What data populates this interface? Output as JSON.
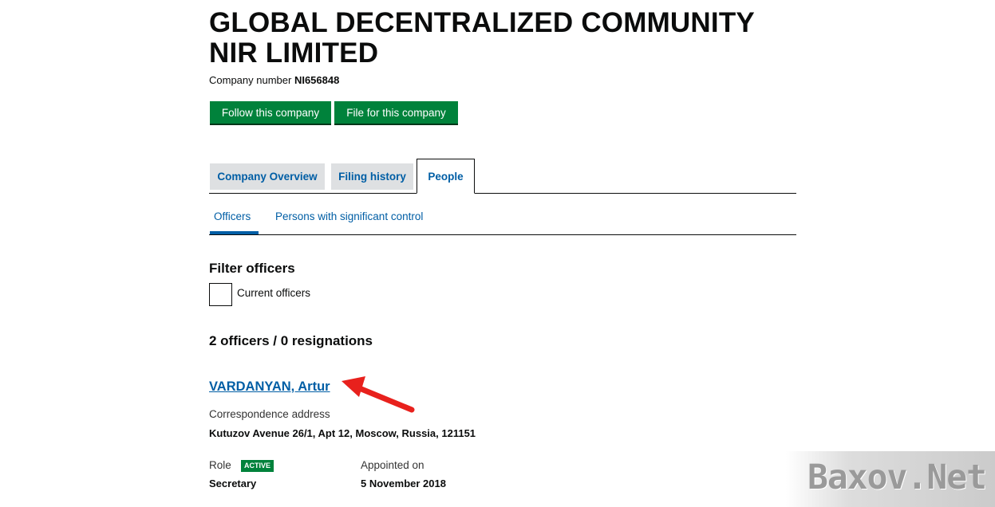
{
  "company": {
    "name_line1": "GLOBAL DECENTRALIZED COMMUNITY",
    "name_line2": "NIR LIMITED",
    "number_label": "Company number",
    "number": "NI656848"
  },
  "actions": {
    "follow_label": "Follow this company",
    "file_label": "File for this company"
  },
  "tabs": [
    {
      "label": "Company Overview",
      "active": false
    },
    {
      "label": "Filing history",
      "active": false
    },
    {
      "label": "People",
      "active": true
    }
  ],
  "subtabs": [
    {
      "label": "Officers",
      "active": true
    },
    {
      "label": "Persons with significant control",
      "active": false
    }
  ],
  "filter": {
    "heading": "Filter officers",
    "checkbox_label": "Current officers",
    "checked": false
  },
  "summary": "2 officers / 0 resignations",
  "officer": {
    "name": "VARDANYAN, Artur",
    "address_label": "Correspondence address",
    "address": "Kutuzov Avenue 26/1, Apt 12, Moscow, Russia, 121151",
    "role_label": "Role",
    "status": "ACTIVE",
    "role": "Secretary",
    "appointed_label": "Appointed on",
    "appointed": "5 November 2018"
  },
  "annotation": {
    "arrow_color": "#e8211d"
  },
  "watermark": "Baxov.Net",
  "colors": {
    "primary_green": "#00823b",
    "link_blue": "#005ea5",
    "tab_grey": "#dee0e2",
    "text": "#0b0c0c"
  }
}
